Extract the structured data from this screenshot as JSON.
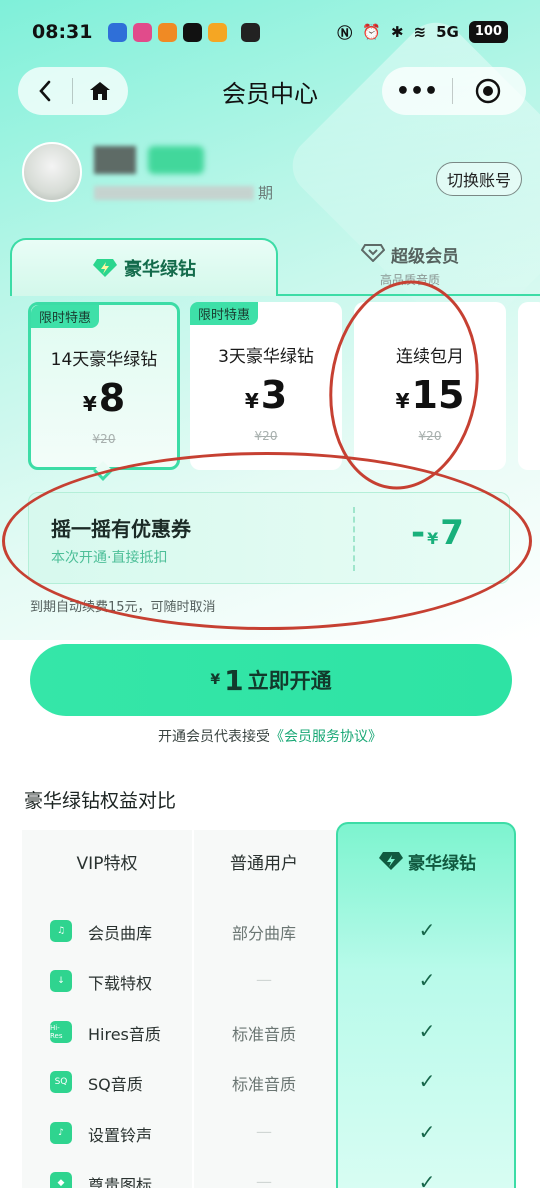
{
  "status_bar": {
    "time": "08:31",
    "battery": "100",
    "signal": "5G"
  },
  "nav": {
    "title": "会员中心",
    "back_icon": "chevron-left-icon",
    "home_icon": "home-icon",
    "more": "•••",
    "target_icon": "target-icon"
  },
  "profile": {
    "expiry_suffix": "期",
    "switch_label": "切换账号"
  },
  "tabs": [
    {
      "label": "豪华绿钻",
      "icon": "lightning-diamond-icon",
      "active": true
    },
    {
      "label": "超级会员",
      "sub": "高品质音质",
      "icon": "diamond-icon",
      "active": false
    }
  ],
  "plans": [
    {
      "tag": "限时特惠",
      "name": "14天豪华绿钻",
      "currency": "¥",
      "price": "8",
      "original": "¥20",
      "selected": true
    },
    {
      "tag": "限时特惠",
      "name": "3天豪华绿钻",
      "currency": "¥",
      "price": "3",
      "original": "¥20",
      "selected": false
    },
    {
      "tag": "",
      "name": "连续包月",
      "currency": "¥",
      "price": "15",
      "original": "¥20",
      "selected": false
    }
  ],
  "coupon": {
    "title": "摇一摇有优惠券",
    "subtitle": "本次开通·直接抵扣",
    "minus": "-",
    "currency": "¥",
    "amount": "7"
  },
  "auto_renew": "到期自动续费15元，可随时取消",
  "open_button": {
    "currency": "¥",
    "amount": "1",
    "label": "立即开通"
  },
  "agreement": {
    "prefix": "开通会员代表接受",
    "link": "《会员服务协议》"
  },
  "compare": {
    "title": "豪华绿钻权益对比",
    "headers": [
      "VIP特权",
      "普通用户",
      "豪华绿钻"
    ],
    "rows": [
      {
        "icon": "music-library-icon",
        "icon_text": "♫",
        "label": "会员曲库",
        "normal": "部分曲库",
        "green": "✓"
      },
      {
        "icon": "download-icon",
        "icon_text": "↓",
        "label": "下载特权",
        "normal": "—",
        "green": "✓"
      },
      {
        "icon": "hires-icon",
        "icon_text": "Hi-Res",
        "label": "Hires音质",
        "normal": "标准音质",
        "green": "✓"
      },
      {
        "icon": "sq-icon",
        "icon_text": "SQ",
        "label": "SQ音质",
        "normal": "标准音质",
        "green": "✓"
      },
      {
        "icon": "bell-icon",
        "icon_text": "♪",
        "label": "设置铃声",
        "normal": "—",
        "green": "✓"
      },
      {
        "icon": "badge-icon",
        "icon_text": "◆",
        "label": "尊贵图标",
        "normal": "—",
        "green": "✓"
      }
    ]
  },
  "colors": {
    "accent": "#3cdca6",
    "button": "#35e6a8",
    "annotation": "#c64032"
  }
}
